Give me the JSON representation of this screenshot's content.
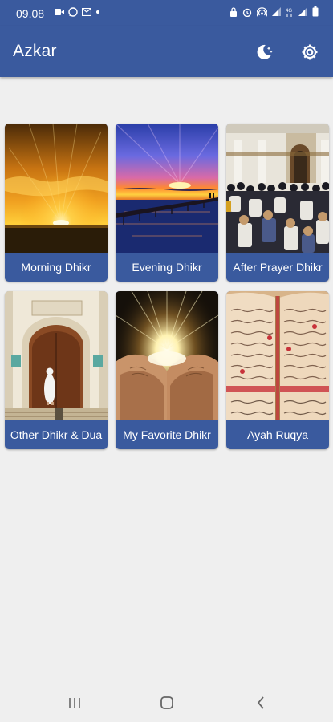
{
  "status_bar": {
    "time": "09.08",
    "left_icons": [
      "video-icon",
      "whatsapp-icon",
      "gmail-icon",
      "dot-icon"
    ],
    "right_icons": [
      "lock-icon",
      "alarm-icon",
      "hotspot-icon",
      "signal-icon",
      "4g-icon",
      "signal-icon",
      "battery-icon"
    ]
  },
  "app_bar": {
    "title": "Azkar",
    "night_mode_icon": "moon-icon",
    "settings_icon": "gear-icon"
  },
  "menu": {
    "items": [
      {
        "label": "Morning Dhikr",
        "image": "sunrise-clouds"
      },
      {
        "label": "Evening Dhikr",
        "image": "sunset-pier"
      },
      {
        "label": "After Prayer Dhikr",
        "image": "mosque-crowd"
      },
      {
        "label": "Other Dhikr & Dua",
        "image": "mosque-door"
      },
      {
        "label": "My Favorite Dhikr",
        "image": "praying-hands-light"
      },
      {
        "label": "Ayah Ruqya",
        "image": "quran-book"
      }
    ]
  },
  "nav_bar": {
    "icons": [
      "recents-icon",
      "home-icon",
      "back-icon"
    ]
  }
}
